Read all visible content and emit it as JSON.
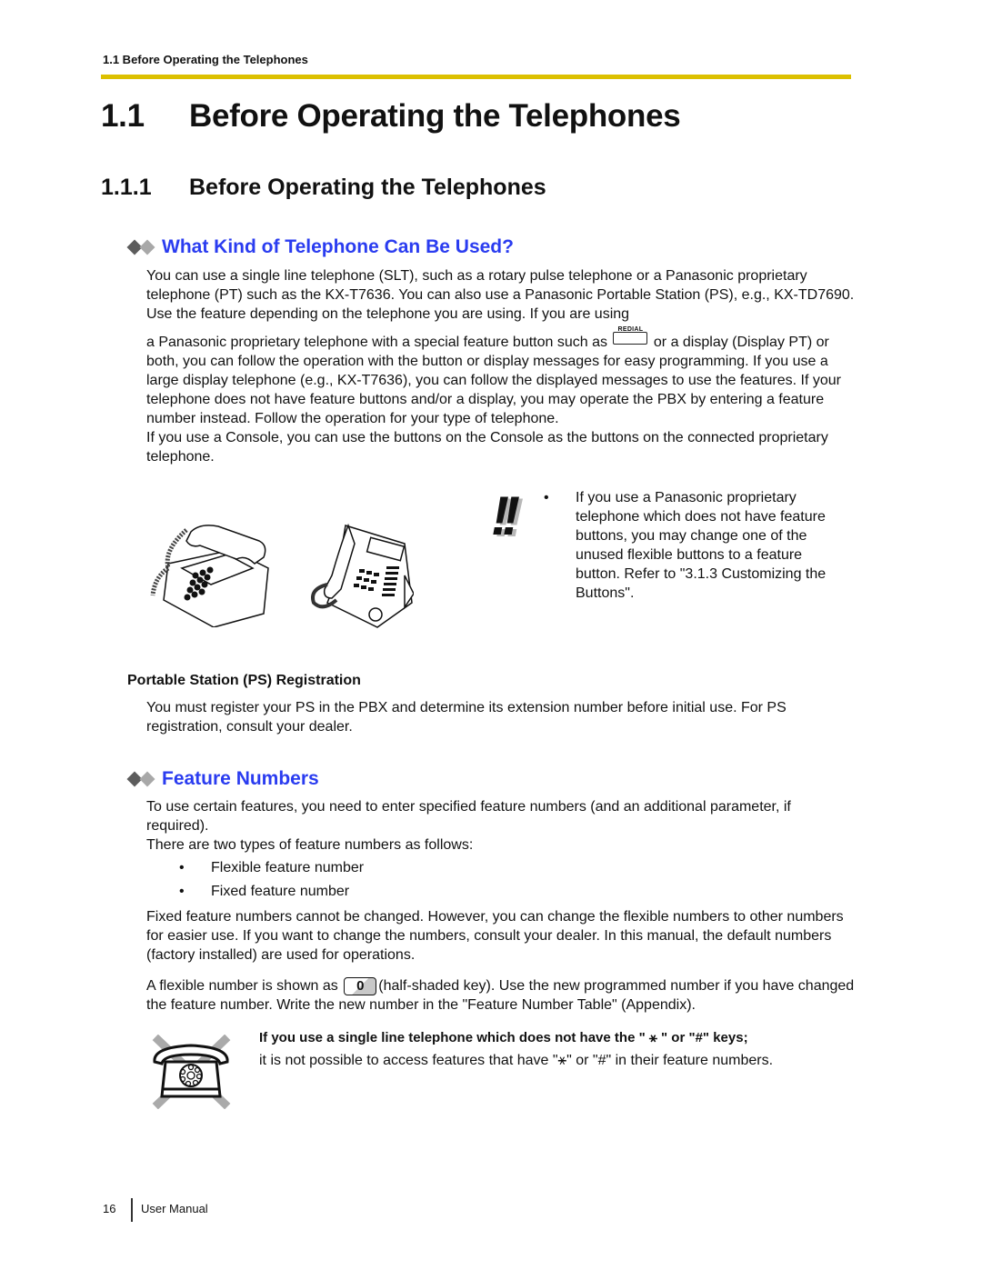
{
  "header": {
    "running_title": "1.1 Before Operating the Telephones",
    "accent_color": "#dcc000"
  },
  "heading1": {
    "number": "1.1",
    "title": "Before Operating the Telephones"
  },
  "heading2": {
    "number": "1.1.1",
    "title": "Before Operating the Telephones"
  },
  "section_what_kind": {
    "title": "What Kind of Telephone Can Be Used?",
    "title_color": "#2a3cf0",
    "para1_lines_a": "You can use a single line telephone (SLT), such as a rotary pulse telephone or a Panasonic proprietary telephone (PT) such as the KX-T7636. You can also use a Panasonic Portable Station (PS), e.g., KX-TD7690. Use the feature depending on the telephone you are using. If you are using",
    "para1_b_before": "a Panasonic proprietary telephone with a special feature button such as",
    "redial_label": "REDIAL",
    "para1_b_after": "or a display (Display PT) or both, you can follow the operation with the button or display messages for easy programming. If you use a large display telephone (e.g., KX-T7636), you can follow the displayed messages to use the features. If your telephone does not have feature buttons and/or a display, you may operate the PBX by entering a feature number instead. Follow the operation for your type of telephone.",
    "para2": "If you use a Console, you can use the buttons on the Console as the buttons on the connected proprietary telephone.",
    "note_mark": "!!",
    "note_bullet": "•",
    "note_text": "If you use a Panasonic proprietary telephone which does not have feature buttons, you may change one of the unused flexible buttons to a feature button. Refer to \"3.1.3 Customizing the Buttons\"."
  },
  "ps_registration": {
    "title": "Portable Station (PS) Registration",
    "text": "You must register your PS in the PBX and determine its extension number before initial use. For PS registration, consult your dealer."
  },
  "section_feature_numbers": {
    "title": "Feature Numbers",
    "intro": "To use certain features, you need to enter specified feature numbers (and an additional parameter, if required).",
    "types_intro": "There are two types of feature numbers as follows:",
    "types": [
      {
        "bullet": "•",
        "label": "Flexible feature number"
      },
      {
        "bullet": "•",
        "label": "Fixed feature number"
      }
    ],
    "para_fixed": "Fixed feature numbers cannot be changed. However, you can change the flexible numbers to other numbers for easier use. If you want to change the numbers, consult your dealer. In this manual, the default numbers (factory installed) are used for operations.",
    "flex_before": "A flexible number is shown as",
    "flex_key": "0",
    "flex_after": "(half-shaded key). Use the new programmed number if you have changed the feature number. Write the new number in the \"Feature Number Table\" (Appendix).",
    "warning_bold": "If you use a single line telephone which does not have the \" ⚹ \" or \"#\" keys;",
    "warning_text": "it is not possible to access features that have \"⚹\" or \"#\" in their feature numbers."
  },
  "footer": {
    "page_number": "16",
    "label": "User Manual"
  }
}
